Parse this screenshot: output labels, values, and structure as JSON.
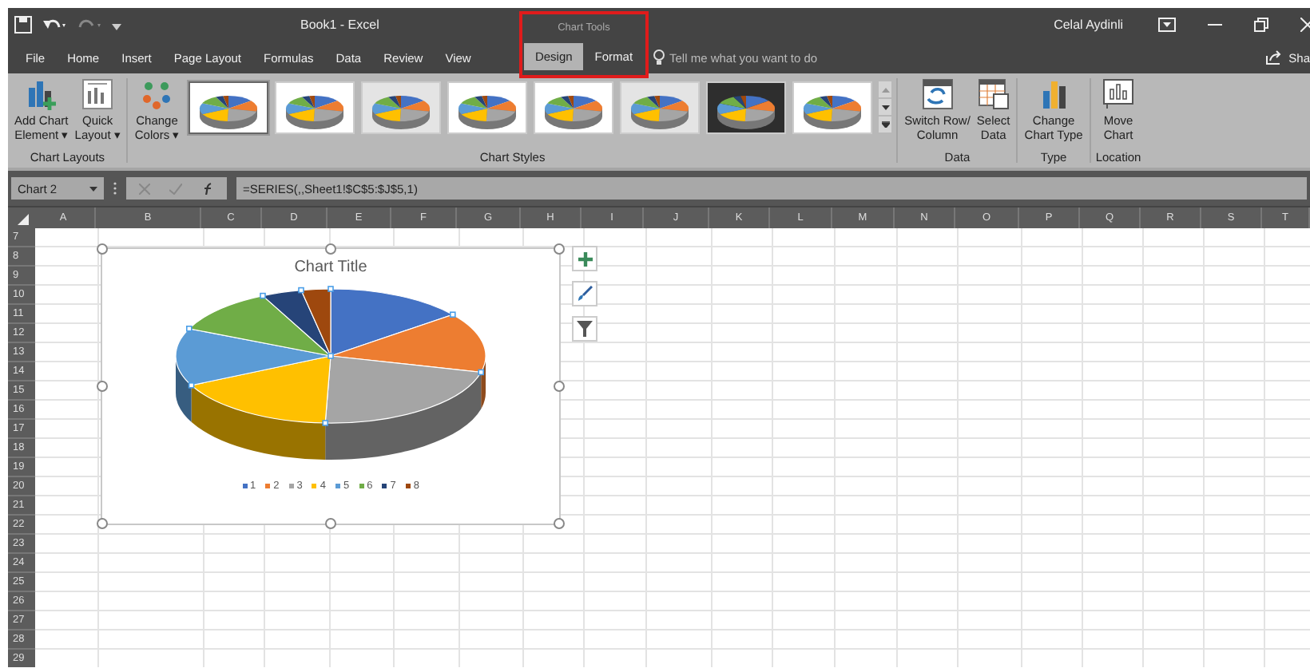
{
  "window": {
    "title": "Book1  -  Excel",
    "context_title": "Chart Tools",
    "user": "Celal Aydinli"
  },
  "tabs": [
    {
      "label": "File",
      "selected": false,
      "contextual": false
    },
    {
      "label": "Home",
      "selected": false,
      "contextual": false
    },
    {
      "label": "Insert",
      "selected": false,
      "contextual": false
    },
    {
      "label": "Page Layout",
      "selected": false,
      "contextual": false
    },
    {
      "label": "Formulas",
      "selected": false,
      "contextual": false
    },
    {
      "label": "Data",
      "selected": false,
      "contextual": false
    },
    {
      "label": "Review",
      "selected": false,
      "contextual": false
    },
    {
      "label": "View",
      "selected": false,
      "contextual": false
    },
    {
      "label": "Design",
      "selected": true,
      "contextual": true
    },
    {
      "label": "Format",
      "selected": false,
      "contextual": true
    }
  ],
  "tell_me": {
    "placeholder": "Tell me what you want to do"
  },
  "share": "Sha",
  "ribbon": {
    "chart_layouts": {
      "label": "Chart Layouts",
      "buttons": [
        [
          "Add Chart",
          "Element ▾"
        ],
        [
          "Quick",
          "Layout ▾"
        ]
      ]
    },
    "change_colors": [
      "Change",
      "Colors ▾"
    ],
    "chart_styles": {
      "label": "Chart Styles",
      "styles": [
        {
          "kind": "white",
          "selected": true
        },
        {
          "kind": "white",
          "selected": false
        },
        {
          "kind": "shaded",
          "selected": false
        },
        {
          "kind": "white",
          "selected": false
        },
        {
          "kind": "white",
          "selected": false
        },
        {
          "kind": "shaded",
          "selected": false
        },
        {
          "kind": "dark",
          "selected": false
        },
        {
          "kind": "white",
          "selected": false
        }
      ]
    },
    "data": {
      "label": "Data",
      "buttons": [
        [
          "Switch Row/",
          "Column"
        ],
        [
          "Select",
          "Data"
        ]
      ]
    },
    "type": {
      "label": "Type",
      "buttons": [
        [
          "Change",
          "Chart Type"
        ]
      ]
    },
    "location": {
      "label": "Location",
      "buttons": [
        [
          "Move",
          "Chart"
        ]
      ]
    }
  },
  "name_box": "Chart 2",
  "formula": "=SERIES(,,Sheet1!$C$5:$J$5,1)",
  "columns": [
    "A",
    "B",
    "C",
    "D",
    "E",
    "F",
    "G",
    "H",
    "I",
    "J",
    "K",
    "L",
    "M",
    "N",
    "O",
    "P",
    "Q",
    "R",
    "S",
    "T"
  ],
  "rows": [
    "7",
    "8",
    "9",
    "10",
    "11",
    "12",
    "13",
    "14",
    "15",
    "16",
    "17",
    "18",
    "19",
    "20",
    "21",
    "22",
    "23",
    "24",
    "25",
    "26",
    "27",
    "28",
    "29"
  ],
  "chart": {
    "title": "Chart Title",
    "legend": [
      {
        "label": "1",
        "color": "#4472c4"
      },
      {
        "label": "2",
        "color": "#ed7d31"
      },
      {
        "label": "3",
        "color": "#a5a5a5"
      },
      {
        "label": "4",
        "color": "#ffc000"
      },
      {
        "label": "5",
        "color": "#5b9bd5"
      },
      {
        "label": "6",
        "color": "#70ad47"
      },
      {
        "label": "7",
        "color": "#264478"
      },
      {
        "label": "8",
        "color": "#9e480e"
      }
    ]
  }
}
